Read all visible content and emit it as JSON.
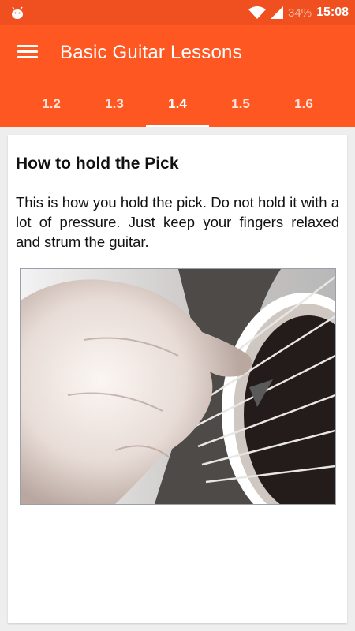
{
  "statusbar": {
    "battery_percent": "34%",
    "time": "15:08",
    "icons": [
      "android-icon",
      "wifi-icon",
      "signal-icon",
      "battery-icon"
    ]
  },
  "appbar": {
    "title": "Basic Guitar Lessons",
    "menu_icon": "hamburger-menu-icon",
    "tabs": [
      {
        "label": "1.2"
      },
      {
        "label": "1.3"
      },
      {
        "label": "1.4",
        "selected": true
      },
      {
        "label": "1.5"
      },
      {
        "label": "1.6"
      }
    ]
  },
  "lesson": {
    "heading": "How to hold the Pick",
    "body": "This is how you hold the pick. Do not hold it with a lot of pressure. Just keep your fingers relaxed and strum the guitar."
  },
  "colors": {
    "primary": "#ff5722",
    "status_bar": "#f0501f",
    "background": "#eeeeee"
  }
}
